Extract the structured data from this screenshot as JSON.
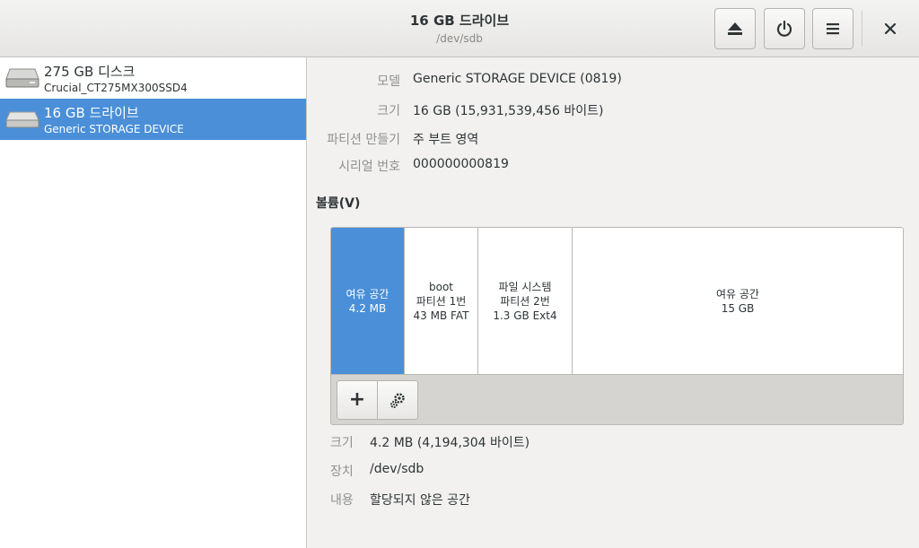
{
  "header": {
    "title": "16 GB 드라이브",
    "subtitle": "/dev/sdb",
    "eject_icon": "eject-icon",
    "power_icon": "power-icon",
    "menu_icon": "menu-icon",
    "close_icon": "close-icon"
  },
  "sidebar": {
    "drives": [
      {
        "name": "275 GB 디스크",
        "model": "Crucial_CT275MX300SSD4",
        "selected": false,
        "icon": "hard-disk-icon"
      },
      {
        "name": "16 GB 드라이브",
        "model": "Generic STORAGE DEVICE",
        "selected": true,
        "icon": "removable-drive-icon"
      }
    ]
  },
  "drive_info": {
    "model_label": "모델",
    "model_value": "Generic STORAGE DEVICE (0819)",
    "size_label": "크기",
    "size_value": "16 GB (15,931,539,456 바이트)",
    "partitioning_label": "파티션 만들기",
    "partitioning_value": "주 부트 영역",
    "serial_label": "시리얼 번호",
    "serial_value": "000000000819"
  },
  "volumes": {
    "heading": "볼륨(V)",
    "partitions": [
      {
        "line1": "여유 공간",
        "line2": "4.2 MB",
        "line3": "",
        "selected": true
      },
      {
        "line1": "boot",
        "line2": "파티션 1번",
        "line3": "43 MB FAT",
        "selected": false
      },
      {
        "line1": "파일 시스템",
        "line2": "파티션 2번",
        "line3": "1.3 GB Ext4",
        "selected": false
      },
      {
        "line1": "여유 공간",
        "line2": "15 GB",
        "line3": "",
        "selected": false
      }
    ],
    "add_button": "+",
    "settings_icon": "gears-icon"
  },
  "selected_volume": {
    "size_label": "크기",
    "size_value": "4.2 MB (4,194,304 바이트)",
    "device_label": "장치",
    "device_value": "/dev/sdb",
    "contents_label": "내용",
    "contents_value": "할당되지 않은 공간"
  },
  "colors": {
    "selection": "#4a8fd8",
    "background": "#f2f1f0"
  }
}
